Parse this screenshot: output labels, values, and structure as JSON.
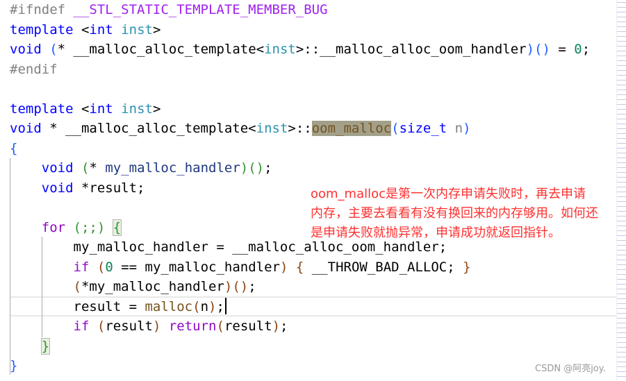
{
  "editor": {
    "lines": [
      [
        [
          "#ifndef ",
          "pp"
        ],
        [
          "__STL_STATIC_TEMPLATE_MEMBER_BUG",
          "mac"
        ]
      ],
      [
        [
          "template",
          "kw"
        ],
        [
          " <",
          ""
        ],
        [
          "int",
          "kw"
        ],
        [
          " ",
          ""
        ],
        [
          "inst",
          "ty"
        ],
        [
          ">",
          ""
        ]
      ],
      [
        [
          "void",
          "kw"
        ],
        [
          " ",
          ""
        ],
        [
          "(",
          "p1"
        ],
        [
          "* __malloc_alloc_template<",
          ""
        ],
        [
          "inst",
          "ty"
        ],
        [
          ">::__malloc_alloc_oom_handler",
          ""
        ],
        [
          ")()",
          "p1"
        ],
        [
          " = ",
          ""
        ],
        [
          "0",
          "num"
        ],
        [
          ";",
          ""
        ]
      ],
      [
        [
          "#endif",
          "pp"
        ]
      ],
      [],
      [
        [
          "template",
          "kw"
        ],
        [
          " <",
          ""
        ],
        [
          "int",
          "kw"
        ],
        [
          " ",
          ""
        ],
        [
          "inst",
          "ty"
        ],
        [
          ">",
          ""
        ]
      ],
      [
        [
          "void",
          "kw"
        ],
        [
          " * __malloc_alloc_template<",
          ""
        ],
        [
          "inst",
          "ty"
        ],
        [
          ">::",
          ""
        ],
        [
          "oom_malloc",
          "fn hl"
        ],
        [
          "(",
          "p1"
        ],
        [
          "size_t",
          "kw"
        ],
        [
          " ",
          ""
        ],
        [
          "n",
          "prm"
        ],
        [
          ")",
          "p1"
        ]
      ],
      [
        [
          "{",
          "p1"
        ]
      ],
      [
        [
          "    ",
          ""
        ],
        [
          "void",
          "kw"
        ],
        [
          " ",
          ""
        ],
        [
          "(",
          "p3"
        ],
        [
          "* ",
          ""
        ],
        [
          "my_malloc_handler",
          "loc"
        ],
        [
          ")()",
          "p3"
        ],
        [
          ";",
          ""
        ]
      ],
      [
        [
          "    ",
          ""
        ],
        [
          "void",
          "kw"
        ],
        [
          " *result;",
          ""
        ]
      ],
      [],
      [
        [
          "    ",
          ""
        ],
        [
          "for",
          "ctl"
        ],
        [
          " ",
          ""
        ],
        [
          "(;;)",
          "p3"
        ],
        [
          " ",
          ""
        ],
        [
          "{",
          "p3 box"
        ]
      ],
      [
        [
          "        my_malloc_handler = __malloc_alloc_oom_handler;",
          ""
        ]
      ],
      [
        [
          "        ",
          ""
        ],
        [
          "if",
          "ctl"
        ],
        [
          " ",
          ""
        ],
        [
          "(",
          "p2"
        ],
        [
          "0",
          "num"
        ],
        [
          " == my_malloc_handler",
          ""
        ],
        [
          ")",
          "p2"
        ],
        [
          " ",
          ""
        ],
        [
          "{",
          "p2"
        ],
        [
          " __THROW_BAD_ALLOC; ",
          ""
        ],
        [
          "}",
          "p2"
        ]
      ],
      [
        [
          "        ",
          ""
        ],
        [
          "(",
          "p2"
        ],
        [
          "*my_malloc_handler",
          ""
        ],
        [
          ")()",
          "p2"
        ],
        [
          ";",
          ""
        ]
      ],
      [
        [
          "        result = ",
          ""
        ],
        [
          "malloc",
          "fn"
        ],
        [
          "(",
          "p2"
        ],
        [
          "n",
          ""
        ],
        [
          ")",
          "p2"
        ],
        [
          ";",
          ""
        ]
      ],
      [
        [
          "        ",
          ""
        ],
        [
          "if",
          "ctl"
        ],
        [
          " ",
          ""
        ],
        [
          "(",
          "p2"
        ],
        [
          "result",
          ""
        ],
        [
          ")",
          "p2"
        ],
        [
          " ",
          ""
        ],
        [
          "return",
          "ctl"
        ],
        [
          "(",
          "p2"
        ],
        [
          "result",
          ""
        ],
        [
          ")",
          "p2"
        ],
        [
          ";",
          ""
        ]
      ],
      [
        [
          "    ",
          ""
        ],
        [
          "}",
          "p3 box"
        ]
      ],
      [
        [
          "}",
          "p1"
        ]
      ]
    ]
  },
  "annotation": {
    "lines": [
      "oom_malloc是第一次内存申请失败时，再去申请",
      "内存，主要去看看有没有换回来的内存够用。如何还",
      "是申请失败就抛异常，申请成功就返回指针。"
    ],
    "color": "#ff3030"
  },
  "watermark": "CSDN @阿亮joy."
}
